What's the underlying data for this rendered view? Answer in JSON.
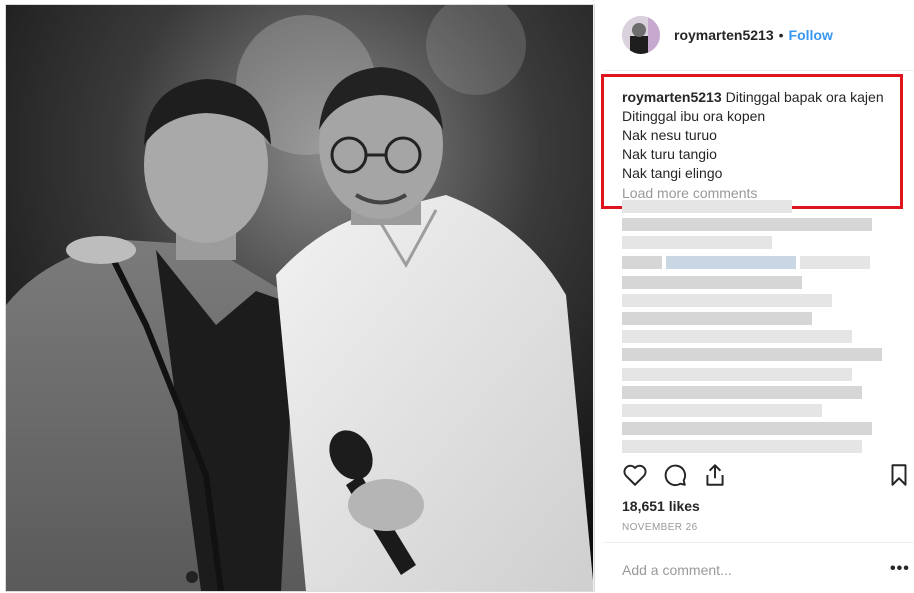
{
  "post": {
    "username": "roymarten5213",
    "follow_label": "Follow",
    "separator": "•"
  },
  "caption": {
    "username": "roymarten5213",
    "lines": [
      "Ditinggal bapak ora kajen",
      "Ditinggal ibu ora kopen",
      "Nak nesu turuo",
      "Nak turu tangio",
      "Nak tangi elingo"
    ],
    "load_more": "Load more comments"
  },
  "stats": {
    "likes": "18,651 likes",
    "date": "NOVEMBER 26"
  },
  "comment": {
    "placeholder": "Add a comment...",
    "more_glyph": "•••"
  },
  "icons": {
    "like": "heart-icon",
    "comment": "speech-bubble-icon",
    "share": "share-icon",
    "save": "bookmark-icon"
  },
  "colors": {
    "follow": "#3897f0",
    "highlight_border": "#e0141e",
    "muted_text": "#999999"
  }
}
